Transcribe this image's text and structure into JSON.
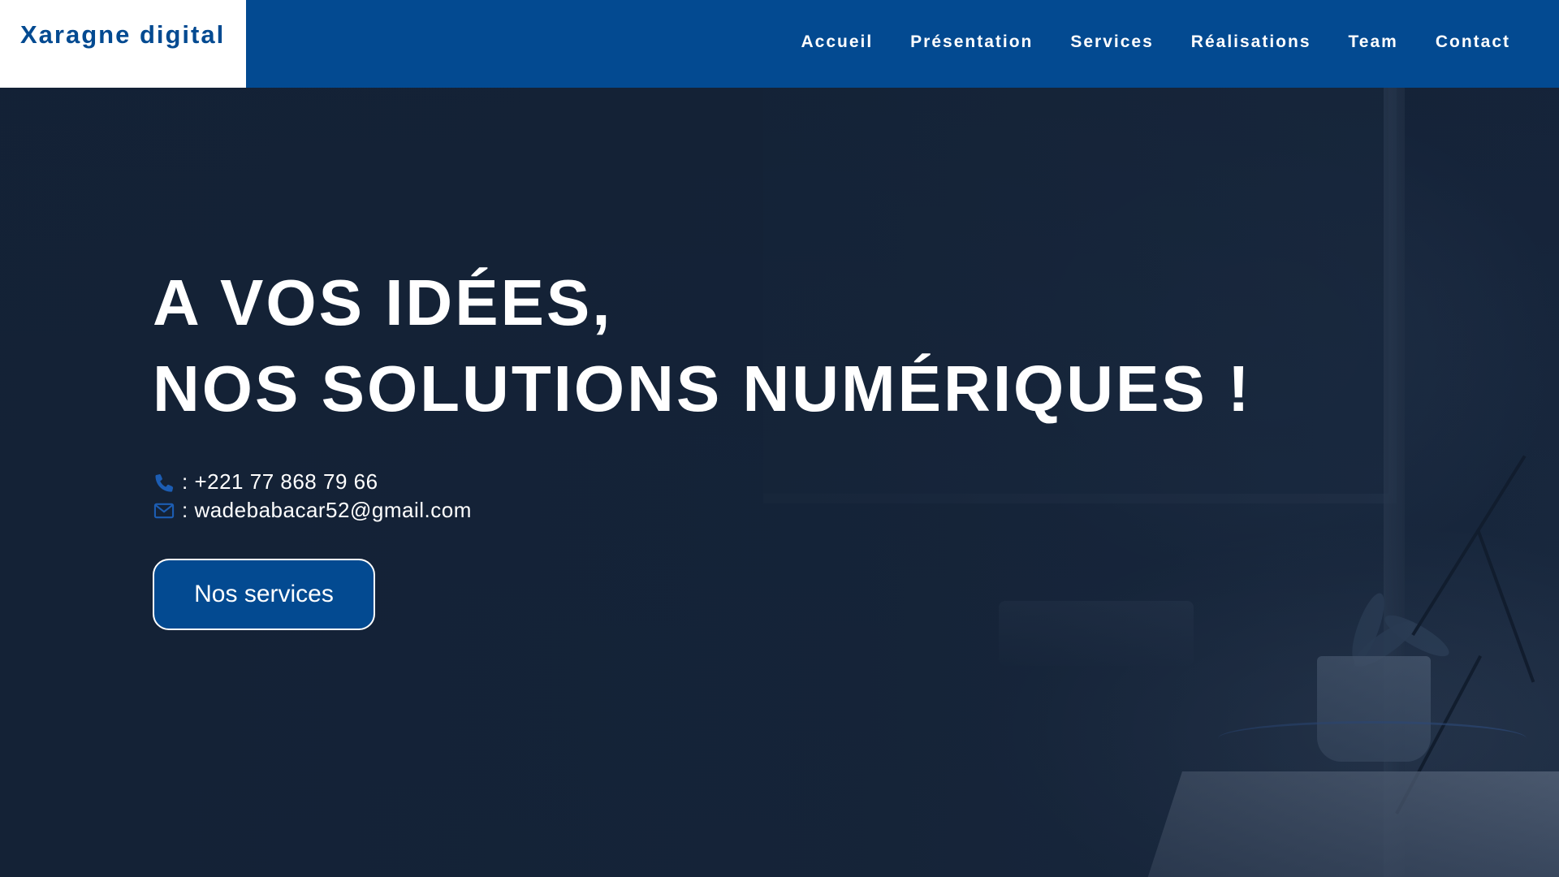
{
  "brand": {
    "name": "Xaragne digital",
    "color": "#034a91"
  },
  "nav": {
    "items": [
      {
        "label": "Accueil"
      },
      {
        "label": "Présentation"
      },
      {
        "label": "Services"
      },
      {
        "label": "Réalisations"
      },
      {
        "label": "Team"
      },
      {
        "label": "Contact"
      }
    ]
  },
  "hero": {
    "headline_line1": "A VOS IDÉES,",
    "headline_line2": "NOS SOLUTIONS NUMÉRIQUES !",
    "phone": {
      "icon": "phone-icon",
      "text": ": +221 77 868 79 66"
    },
    "email": {
      "icon": "envelope-icon",
      "text": ": wadebabacar52@gmail.com"
    },
    "cta_label": "Nos services"
  },
  "colors": {
    "header_bg": "#034a91",
    "hero_bg": "#17263b",
    "icon_accent": "#1c5db3",
    "text_light": "#ffffff"
  }
}
